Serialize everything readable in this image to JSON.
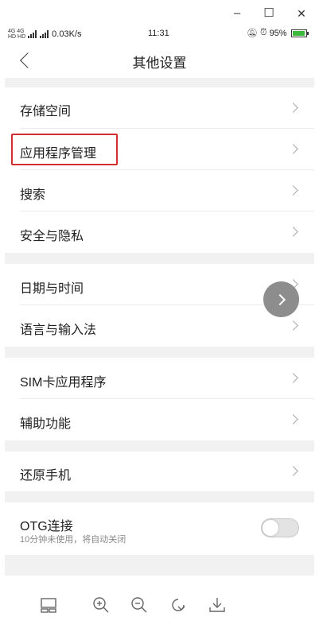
{
  "window": {
    "minimize": "–",
    "maximize": "☐",
    "close": "✕"
  },
  "status_bar": {
    "network_top": "4G 4G",
    "network_bottom": "HD HD",
    "speed": "0.03K/s",
    "time": "11:31",
    "battery": "95%",
    "battery_level": 0.95,
    "battery_color": "#3cb93c"
  },
  "header": {
    "title": "其他设置"
  },
  "items": {
    "storage": "存储空间",
    "app_mgmt": "应用程序管理",
    "search": "搜索",
    "security": "安全与隐私",
    "datetime": "日期与时间",
    "language": "语言与输入法",
    "sim_apps": "SIM卡应用程序",
    "accessibility": "辅助功能",
    "reset": "还原手机",
    "otg": "OTG连接",
    "otg_sub": "10分钟未使用，将自动关闭"
  },
  "otg_enabled": false,
  "highlight_color": "#d32f2f"
}
